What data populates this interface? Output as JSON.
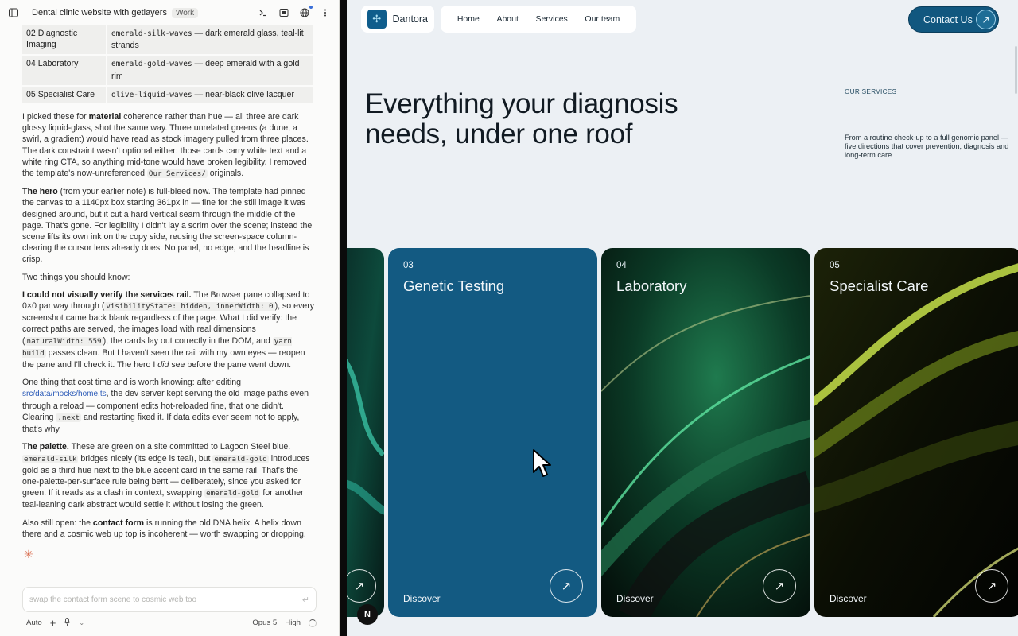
{
  "chat": {
    "title": "Dental clinic website with getlayers",
    "badge": "Work",
    "table": [
      {
        "area": "02 Diagnostic Imaging",
        "asset": "emerald-silk-waves",
        "desc": " — dark emerald glass, teal-lit strands"
      },
      {
        "area": "04 Laboratory",
        "asset": "emerald-gold-waves",
        "desc": " — deep emerald with a gold rim"
      },
      {
        "area": "05 Specialist Care",
        "asset": "olive-liquid-waves",
        "desc": " — near-black olive lacquer"
      }
    ],
    "p1": {
      "a": "I picked these for ",
      "b": "material",
      "c": " coherence rather than hue — all three are dark glossy liquid-glass, shot the same way. Three unrelated greens (a dune, a swirl, a gradient) would have read as stock imagery pulled from three places. The dark constraint wasn't optional either: those cards carry white text and a white ring CTA, so anything mid-tone would have broken legibility. I removed the template's now-unreferenced ",
      "code": "Our Services/",
      "d": " originals."
    },
    "p2": {
      "b": "The hero",
      "a": " (from your earlier note) is full-bleed now. The template had pinned the canvas to a 1140px box starting 361px in — fine for the still image it was designed around, but it cut a hard vertical seam through the middle of the page. That's gone. For legibility I didn't lay a scrim over the scene; instead the scene lifts its own ink on the copy side, reusing the screen-space column-clearing the cursor lens already does. No panel, no edge, and the headline is crisp."
    },
    "p3": "Two things you should know:",
    "p4": {
      "b": "I could not visually verify the services rail.",
      "a": " The Browser pane collapsed to 0×0 partway through (",
      "code1": "visibilityState: hidden, innerWidth: 0",
      "c": "), so every screenshot came back blank regardless of the page. What I did verify: the correct paths are served, the images load with real dimensions (",
      "code2": "naturalWidth: 559",
      "d": "), the cards lay out correctly in the DOM, and ",
      "code3": "yarn build",
      "e": " passes clean. But I haven't seen the rail with my own eyes — reopen the pane and I'll check it. The hero I ",
      "em": "did",
      "f": " see before the pane went down."
    },
    "p5": {
      "a": "One thing that cost time and is worth knowing: after editing ",
      "link": "src/data/mocks/home.ts",
      "b": ", the dev server kept serving the old image paths even through a reload — component edits hot-reloaded fine, that one didn't. Clearing ",
      "code": ".next",
      "c": " and restarting fixed it. If data edits ever seem not to apply, that's why."
    },
    "p6": {
      "b": "The palette.",
      "a": " These are green on a site committed to Lagoon Steel blue. ",
      "code1": "emerald-silk",
      "c": " bridges nicely (its edge is teal), but ",
      "code2": "emerald-gold",
      "d": " introduces gold as a third hue next to the blue accent card in the same rail. That's the one-palette-per-surface rule being bent — deliberately, since you asked for green. If it reads as a clash in context, swapping ",
      "code3": "emerald-gold",
      "e": " for another teal-leaning dark abstract would settle it without losing the green."
    },
    "p7": {
      "a": "Also still open: the ",
      "b": "contact form",
      "c": " is running the old DNA helix. A helix down there and a cosmic web up top is incoherent — worth swapping or dropping."
    },
    "composer_placeholder": "swap the contact form scene to cosmic web too",
    "footer": {
      "mode": "Auto",
      "model": "Opus 5",
      "effort": "High"
    }
  },
  "site": {
    "brand": "Dantora",
    "nav": [
      "Home",
      "About",
      "Services",
      "Our team"
    ],
    "contact_label": "Contact Us",
    "hero_title": "Everything your diagnosis needs, under one roof",
    "section_label": "OUR SERVICES",
    "section_desc": "From a routine check-up to a full genomic panel — five directions that cover prevention, diagnosis and long-term care.",
    "cards": [
      {
        "num": "03",
        "name": "Genetic Testing",
        "cta": "Discover"
      },
      {
        "num": "04",
        "name": "Laboratory",
        "cta": "Discover"
      },
      {
        "num": "05",
        "name": "Specialist Care",
        "cta": "Discover"
      }
    ],
    "badge_letter": "N"
  },
  "colors": {
    "accent": "#135a82",
    "contact": "#11577f",
    "bg": "#ecf0f4"
  }
}
